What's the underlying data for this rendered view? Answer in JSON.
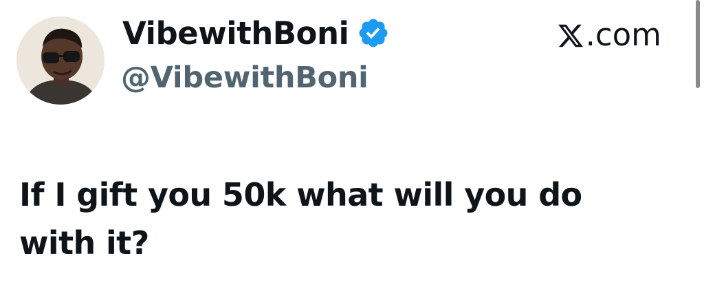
{
  "tweet": {
    "author": {
      "display_name": "VibewithBoni",
      "handle": "@VibewithBoni",
      "verified": true,
      "verified_badge_color": "#1d9bf0",
      "avatar_icon": "profile-photo"
    },
    "platform": {
      "label": ".com",
      "logo_icon": "x-logo-icon"
    },
    "text": "If I gift you 50k what will you do with it?"
  },
  "colors": {
    "text_primary": "#0f1419",
    "text_secondary": "#536471",
    "background": "#ffffff"
  }
}
